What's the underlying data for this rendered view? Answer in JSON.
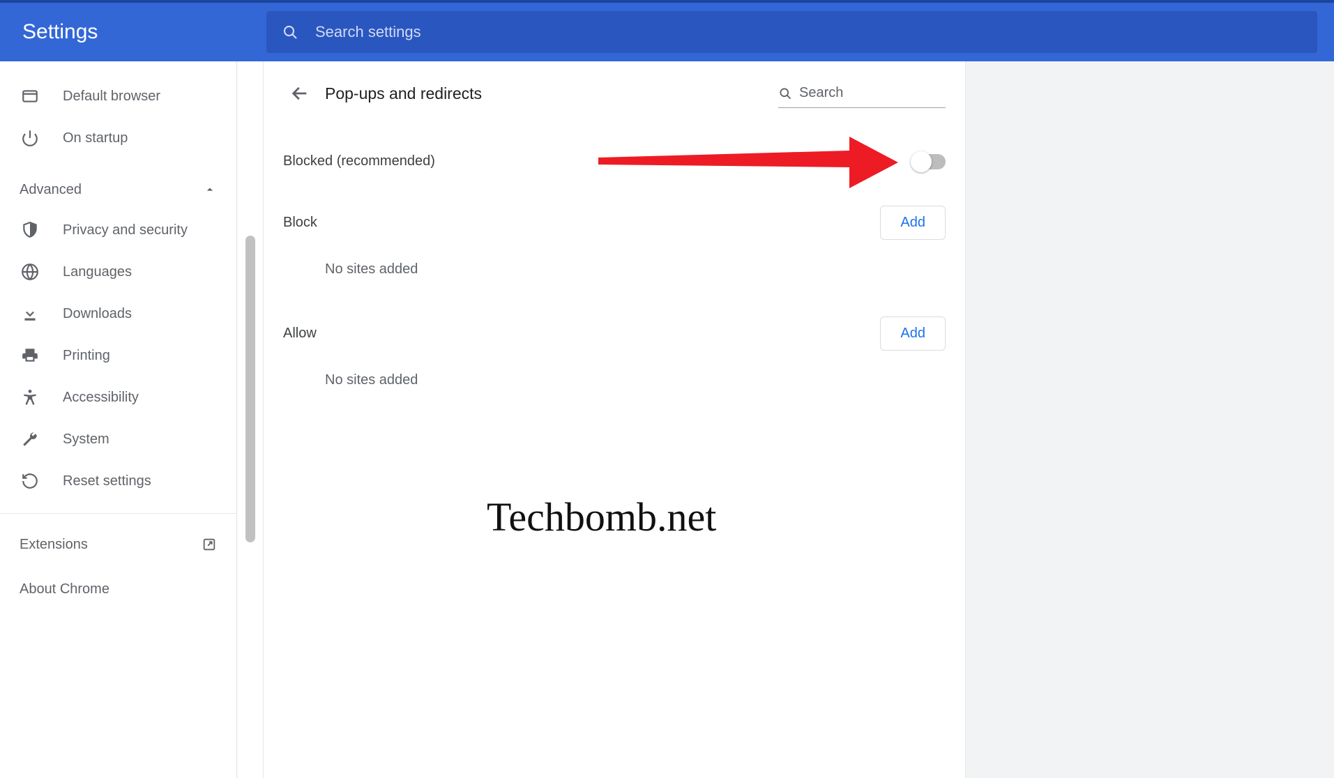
{
  "header": {
    "title": "Settings",
    "search_placeholder": "Search settings"
  },
  "sidebar": {
    "items_top": [
      {
        "icon": "browser",
        "label": "Default browser"
      },
      {
        "icon": "power",
        "label": "On startup"
      }
    ],
    "advanced_label": "Advanced",
    "items_adv": [
      {
        "icon": "shield",
        "label": "Privacy and security"
      },
      {
        "icon": "globe",
        "label": "Languages"
      },
      {
        "icon": "download",
        "label": "Downloads"
      },
      {
        "icon": "printer",
        "label": "Printing"
      },
      {
        "icon": "accessibility",
        "label": "Accessibility"
      },
      {
        "icon": "wrench",
        "label": "System"
      },
      {
        "icon": "restore",
        "label": "Reset settings"
      }
    ],
    "extensions_label": "Extensions",
    "about_label": "About Chrome"
  },
  "page": {
    "title": "Pop-ups and redirects",
    "site_search_placeholder": "Search",
    "blocked_label": "Blocked (recommended)",
    "blocked_toggle": false,
    "block_section": {
      "title": "Block",
      "add_label": "Add",
      "empty": "No sites added"
    },
    "allow_section": {
      "title": "Allow",
      "add_label": "Add",
      "empty": "No sites added"
    }
  },
  "watermark": "Techbomb.net"
}
